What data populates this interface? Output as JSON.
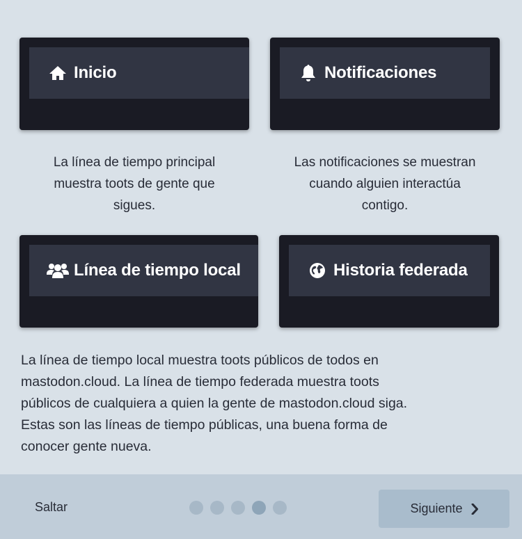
{
  "cards": {
    "home": {
      "title": "Inicio",
      "icon": "home-icon"
    },
    "notifications": {
      "title": "Notificaciones",
      "icon": "bell-icon"
    },
    "local": {
      "title": "Línea de tiempo local",
      "icon": "users-icon"
    },
    "federated": {
      "title": "Historia federada",
      "icon": "globe-icon"
    }
  },
  "descriptions": {
    "home": [
      "La línea de tiempo principal",
      "muestra toots de gente que",
      "sigues."
    ],
    "notifications": [
      "Las notificaciones se muestran",
      "cuando alguien interactúa",
      "contigo."
    ]
  },
  "paragraph": [
    "La línea de tiempo local muestra toots públicos de todos en",
    "mastodon.cloud. La línea de tiempo federada muestra toots",
    "públicos de cualquiera a quien la gente de mastodon.cloud siga.",
    "Estas son las líneas de tiempo públicas, una buena forma de",
    "conocer gente nueva."
  ],
  "footer": {
    "skip_label": "Saltar",
    "next_label": "Siguiente",
    "pages_total": 5,
    "active_page": 4
  },
  "colors": {
    "background": "#d9e1e8",
    "card": "#1a1b24",
    "card_header": "#313543",
    "footer": "#c0cdd9",
    "next_button": "#a9bccc"
  }
}
